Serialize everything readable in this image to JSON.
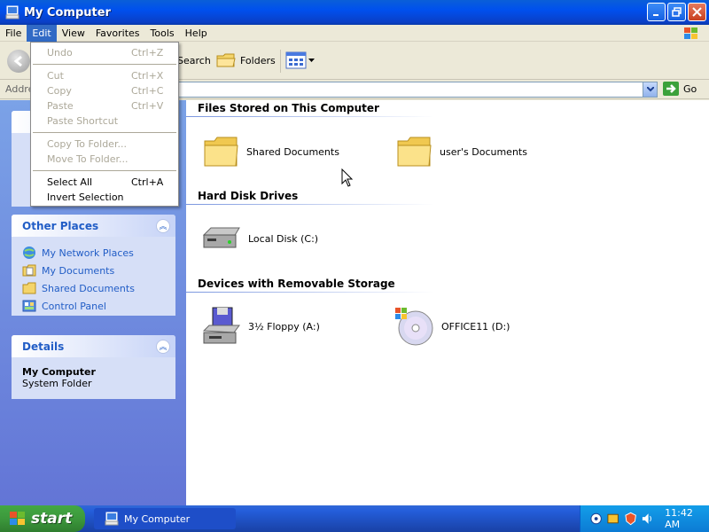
{
  "window": {
    "title": "My Computer"
  },
  "menu": {
    "items": [
      {
        "label": "File"
      },
      {
        "label": "Edit"
      },
      {
        "label": "View"
      },
      {
        "label": "Favorites"
      },
      {
        "label": "Tools"
      },
      {
        "label": "Help"
      }
    ],
    "active": "Edit"
  },
  "edit_menu": {
    "undo": {
      "label": "Undo",
      "shortcut": "Ctrl+Z"
    },
    "cut": {
      "label": "Cut",
      "shortcut": "Ctrl+X"
    },
    "copy": {
      "label": "Copy",
      "shortcut": "Ctrl+C"
    },
    "paste": {
      "label": "Paste",
      "shortcut": "Ctrl+V"
    },
    "paste_shortcut": {
      "label": "Paste Shortcut"
    },
    "copy_to_folder": {
      "label": "Copy To Folder..."
    },
    "move_to_folder": {
      "label": "Move To Folder..."
    },
    "select_all": {
      "label": "Select All",
      "shortcut": "Ctrl+A"
    },
    "invert_selection": {
      "label": "Invert Selection"
    }
  },
  "toolbar": {
    "search_label": "Search",
    "folders_label": "Folders"
  },
  "address": {
    "label": "Address",
    "go_label": "Go"
  },
  "sidebar": {
    "other_places": {
      "title": "Other Places",
      "items": [
        {
          "label": "My Network Places",
          "icon": "network-icon"
        },
        {
          "label": "My Documents",
          "icon": "documents-icon"
        },
        {
          "label": "Shared Documents",
          "icon": "folder-icon"
        },
        {
          "label": "Control Panel",
          "icon": "control-panel-icon"
        }
      ]
    },
    "details": {
      "title": "Details",
      "name": "My Computer",
      "type": "System Folder"
    }
  },
  "content": {
    "groups": [
      {
        "title": "Files Stored on This Computer",
        "items": [
          {
            "label": "Shared Documents",
            "icon": "folder-icon"
          },
          {
            "label": "user's Documents",
            "icon": "folder-icon"
          }
        ]
      },
      {
        "title": "Hard Disk Drives",
        "items": [
          {
            "label": "Local Disk (C:)",
            "icon": "hard-disk-icon"
          }
        ]
      },
      {
        "title": "Devices with Removable Storage",
        "items": [
          {
            "label": "3½ Floppy (A:)",
            "icon": "floppy-icon"
          },
          {
            "label": "OFFICE11 (D:)",
            "icon": "cd-drive-icon"
          }
        ]
      }
    ]
  },
  "taskbar": {
    "start_label": "start",
    "task_label": "My Computer",
    "clock": "11:42 AM"
  },
  "colors": {
    "titlebar": "#0a5fd8",
    "sidebar_bg": "#7ba2e7",
    "link": "#215dc6",
    "menu_highlight": "#316ac5"
  }
}
